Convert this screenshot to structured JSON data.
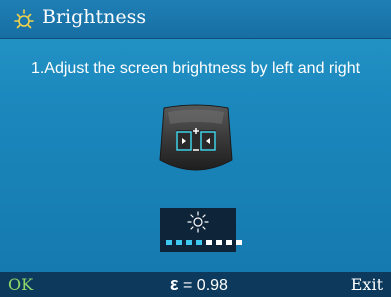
{
  "header": {
    "title": "Brightness",
    "icon": "brightness-sun-icon"
  },
  "main": {
    "instruction": "1.Adjust the screen brightness by left and right",
    "device_icon": "keypad-left-right-icon",
    "brightness_indicator": {
      "icon": "sun-icon",
      "level": 4,
      "max_level": 8
    }
  },
  "footer": {
    "ok_label": "OK",
    "epsilon_symbol": "ε",
    "epsilon_value": "= 0.98",
    "exit_label": "Exit"
  },
  "colors": {
    "ok": "#8ed86a",
    "accent": "#3fc8f0",
    "background": "#1a86bb"
  }
}
